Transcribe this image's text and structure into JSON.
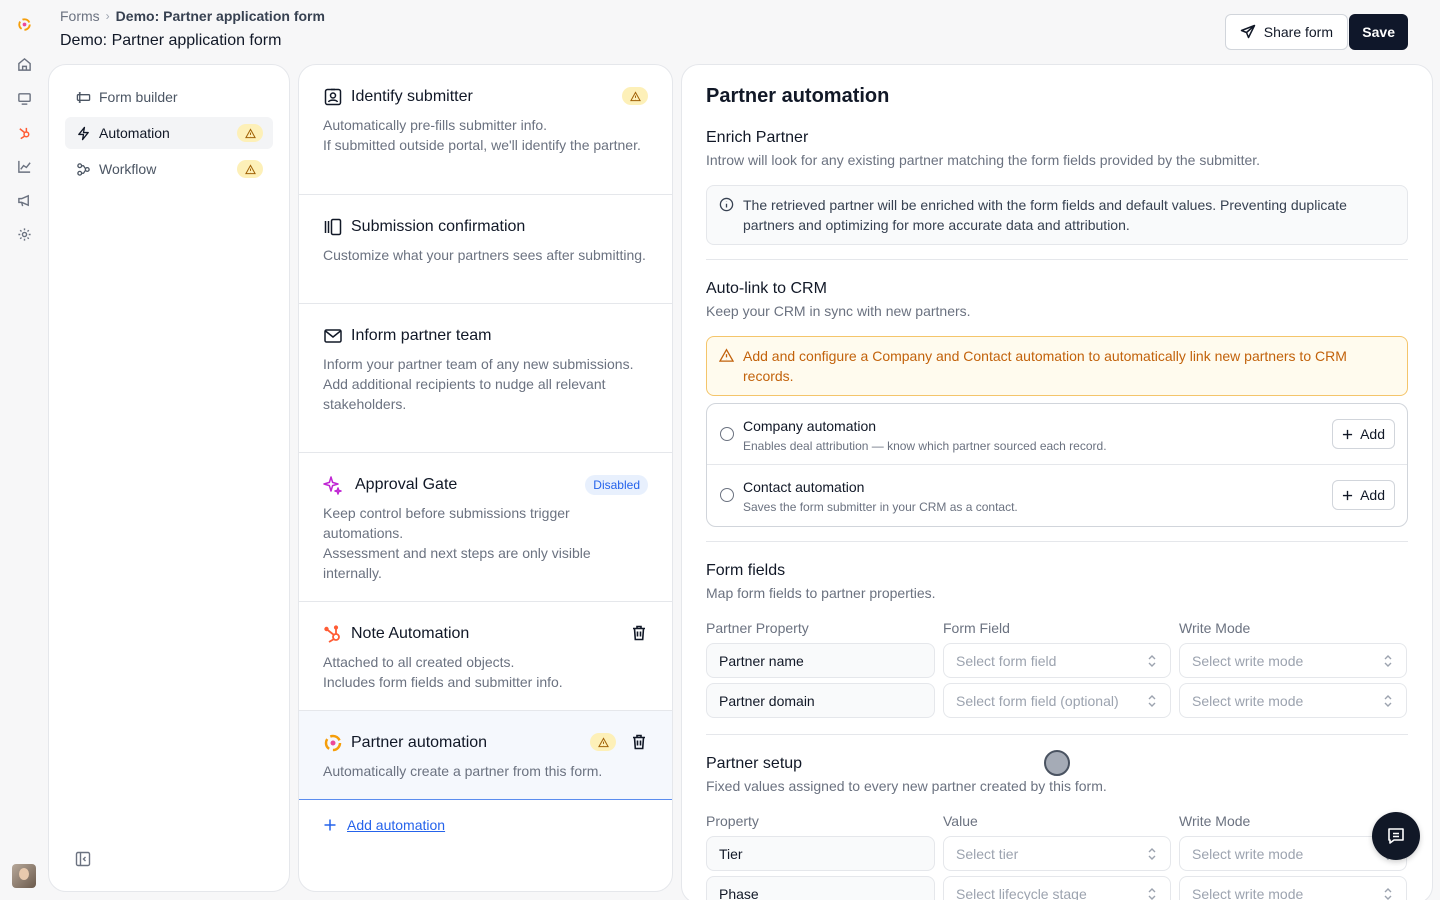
{
  "breadcrumb": {
    "root": "Forms",
    "current": "Demo: Partner application form"
  },
  "page_title": "Demo: Partner application form",
  "actions": {
    "share_label": "Share form",
    "save_label": "Save"
  },
  "rail_icons": [
    "logo-icon",
    "home-icon",
    "monitor-icon",
    "hubspot-icon",
    "chart-icon",
    "megaphone-icon",
    "settings-icon"
  ],
  "nav": {
    "items": [
      {
        "label": "Form builder",
        "icon": "form-builder-icon",
        "warning": false
      },
      {
        "label": "Automation",
        "icon": "lightning-icon",
        "warning": true
      },
      {
        "label": "Workflow",
        "icon": "workflow-icon",
        "warning": true
      }
    ]
  },
  "automations": {
    "cards": [
      {
        "title": "Identify submitter",
        "desc": [
          "Automatically pre-fills submitter info.",
          "If submitted outside portal, we'll identify the partner."
        ],
        "icon": "id-badge-icon",
        "warning": true
      },
      {
        "title": "Submission confirmation",
        "desc": [
          "Customize what your partners sees after submitting."
        ],
        "icon": "columns-icon"
      },
      {
        "title": "Inform partner team",
        "desc": [
          "Inform your partner team of any new submissions.",
          "Add additional recipients to nudge all relevant stakeholders."
        ],
        "icon": "mail-icon"
      },
      {
        "title": "Approval Gate",
        "desc": [
          "Keep control before submissions trigger automations.",
          "Assessment and next steps are only visible internally."
        ],
        "icon": "sparkle-icon",
        "badge": "Disabled"
      },
      {
        "title": "Note Automation",
        "desc": [
          "Attached to all created objects.",
          "Includes form fields and submitter info."
        ],
        "icon": "hubspot-icon"
      },
      {
        "title": "Partner automation",
        "desc": [
          "Automatically create a partner from this form."
        ],
        "icon": "introw-logo-icon",
        "warning": true
      }
    ],
    "add_label": "Add automation"
  },
  "detail": {
    "title": "Partner automation",
    "enrich": {
      "title": "Enrich Partner",
      "subtitle": "Introw will look for any existing partner matching the form fields provided by the submitter.",
      "info": "The retrieved partner will be enriched with the form fields and default values. Preventing duplicate partners and optimizing for more accurate data and attribution."
    },
    "crm": {
      "title": "Auto-link to CRM",
      "subtitle": "Keep your CRM in sync with new partners.",
      "warning": "Add and configure a Company and Contact automation to automatically link new partners to CRM records.",
      "rows": [
        {
          "title": "Company automation",
          "sub": "Enables deal attribution — know which partner sourced each record.",
          "button": "Add"
        },
        {
          "title": "Contact automation",
          "sub": "Saves the form submitter in your CRM as a contact.",
          "button": "Add"
        }
      ]
    },
    "form_fields": {
      "title": "Form fields",
      "subtitle": "Map form fields to partner properties.",
      "columns": [
        "Partner Property",
        "Form Field",
        "Write Mode"
      ],
      "rows": [
        {
          "property": "Partner name",
          "field": "Select form field",
          "mode": "Select write mode"
        },
        {
          "property": "Partner domain",
          "field": "Select form field (optional)",
          "mode": "Select write mode"
        }
      ]
    },
    "setup": {
      "title": "Partner setup",
      "subtitle": "Fixed values assigned to every new partner created by this form.",
      "columns": [
        "Property",
        "Value",
        "Write Mode"
      ],
      "rows": [
        {
          "property": "Tier",
          "value": "Select tier",
          "mode": "Select write mode"
        },
        {
          "property": "Phase",
          "value": "Select lifecycle stage",
          "mode": "Select write mode"
        }
      ]
    }
  },
  "colors": {
    "primary": "#0f172a",
    "link": "#2563eb",
    "warning_text": "#c2620b",
    "warning_bg": "#fffbee",
    "hubspot": "#ff5c35"
  }
}
